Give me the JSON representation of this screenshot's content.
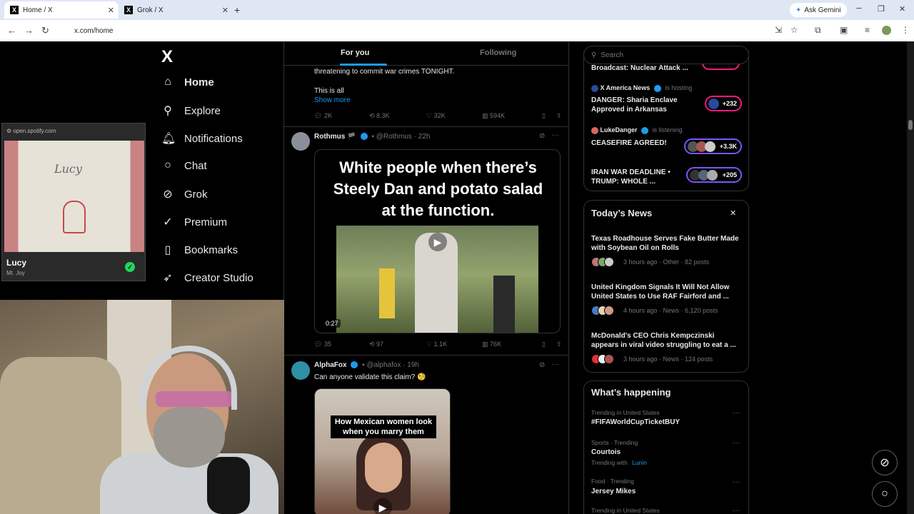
{
  "browser": {
    "tabs": [
      {
        "label": "Home / X",
        "icon": "x-logo-icon",
        "active": true
      },
      {
        "label": "Grok / X",
        "icon": "x-logo-icon",
        "active": false
      }
    ],
    "ask_gemini": "Ask Gemini",
    "url": "x.com/home"
  },
  "sidebar": {
    "logo": "X",
    "items": [
      {
        "label": "Home",
        "icon": "home-icon"
      },
      {
        "label": "Explore",
        "icon": "search-icon"
      },
      {
        "label": "Notifications",
        "icon": "bell-icon"
      },
      {
        "label": "Chat",
        "icon": "chat-icon"
      },
      {
        "label": "Grok",
        "icon": "grok-icon"
      },
      {
        "label": "Premium",
        "icon": "premium-icon"
      },
      {
        "label": "Bookmarks",
        "icon": "bookmark-icon"
      },
      {
        "label": "Creator Studio",
        "icon": "rocket-icon"
      }
    ]
  },
  "timeline": {
    "tabs": [
      "For you",
      "Following"
    ],
    "post0": {
      "text1": "threatening to commit war crimes TONIGHT.",
      "text2": "This is all",
      "show_more": "Show more",
      "replies": "2K",
      "reposts": "8.3K",
      "likes": "32K",
      "views": "594K"
    },
    "post1": {
      "name": "Rothmus",
      "handle": "@Rothmus",
      "time": "· 22h",
      "meme": "White people when there’s Steely Dan and potato salad at the function.",
      "duration": "0:27",
      "replies": "35",
      "reposts": "97",
      "likes": "1.1K",
      "views": "76K"
    },
    "post2": {
      "name": "AlphaFox",
      "handle": "@alphafox",
      "time": "· 19h",
      "text": "Can anyone validate this claim? 🧐",
      "caption": "How Mexican women look when you marry them"
    }
  },
  "right": {
    "search_placeholder": "Search",
    "live": [
      {
        "title": "Broadcast: Nuclear Attack ...",
        "count": ""
      },
      {
        "host": "X America News",
        "status": "is hosting",
        "title": "DANGER: Sharia Enclave Approved in Arkansas",
        "count": "+232"
      },
      {
        "host": "LukeDanger",
        "status": "is listening",
        "title": "CEASEFIRE AGREED!",
        "count": "+3.3K"
      },
      {
        "title": "IRAN WAR DEADLINE • TRUMP: WHOLE ...",
        "count": "+205"
      }
    ],
    "news": {
      "heading": "Today’s News",
      "items": [
        {
          "title": "Texas Roadhouse Serves Fake Butter Made with Soybean Oil on Rolls",
          "meta": "3 hours ago · Other · 82 posts"
        },
        {
          "title": "United Kingdom Signals It Will Not Allow United States to Use RAF Fairford and ...",
          "meta": "4 hours ago · News · 6,120 posts"
        },
        {
          "title": "McDonald's CEO Chris Kempczinski appears in viral video struggling to eat a ...",
          "meta": "3 hours ago · News · 124 posts"
        }
      ]
    },
    "happening": {
      "heading": "What’s happening",
      "items": [
        {
          "category": "Trending in United States",
          "name": "#FIFAWorldCupTicketBUY"
        },
        {
          "category": "Sports · Trending",
          "name": "Courtois",
          "extra_prefix": "Trending with",
          "extra_link": "Lunin"
        },
        {
          "category": "Food · Trending",
          "name": "Jersey Mikes"
        },
        {
          "category": "Trending in United States",
          "name": ""
        }
      ]
    }
  },
  "spotify": {
    "source": "open.spotify.com",
    "title": "Lucy",
    "artist": "Mt. Joy",
    "art_text": "Lucy"
  },
  "colors": {
    "accent": "#1d9bf0",
    "background": "#000000",
    "border": "#2f3336",
    "spotify_green": "#1ed760"
  }
}
